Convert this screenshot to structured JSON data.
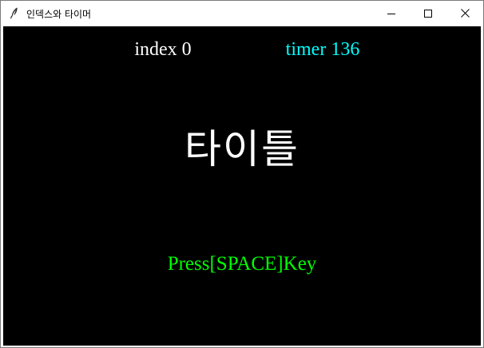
{
  "window": {
    "title": "인덱스와 타이머",
    "icon": "feather-icon",
    "controls": {
      "minimize_icon": "minimize-icon",
      "maximize_icon": "maximize-icon",
      "close_icon": "close-icon"
    }
  },
  "game": {
    "background_color": "#000000",
    "hud": {
      "index_text": "index 0",
      "index_color": "#ffffff",
      "timer_text": "timer 136",
      "timer_color": "#00ffff"
    },
    "title_text": "타이틀",
    "title_color": "#ffffff",
    "prompt_text": "Press[SPACE]Key",
    "prompt_color": "#00ff00"
  }
}
